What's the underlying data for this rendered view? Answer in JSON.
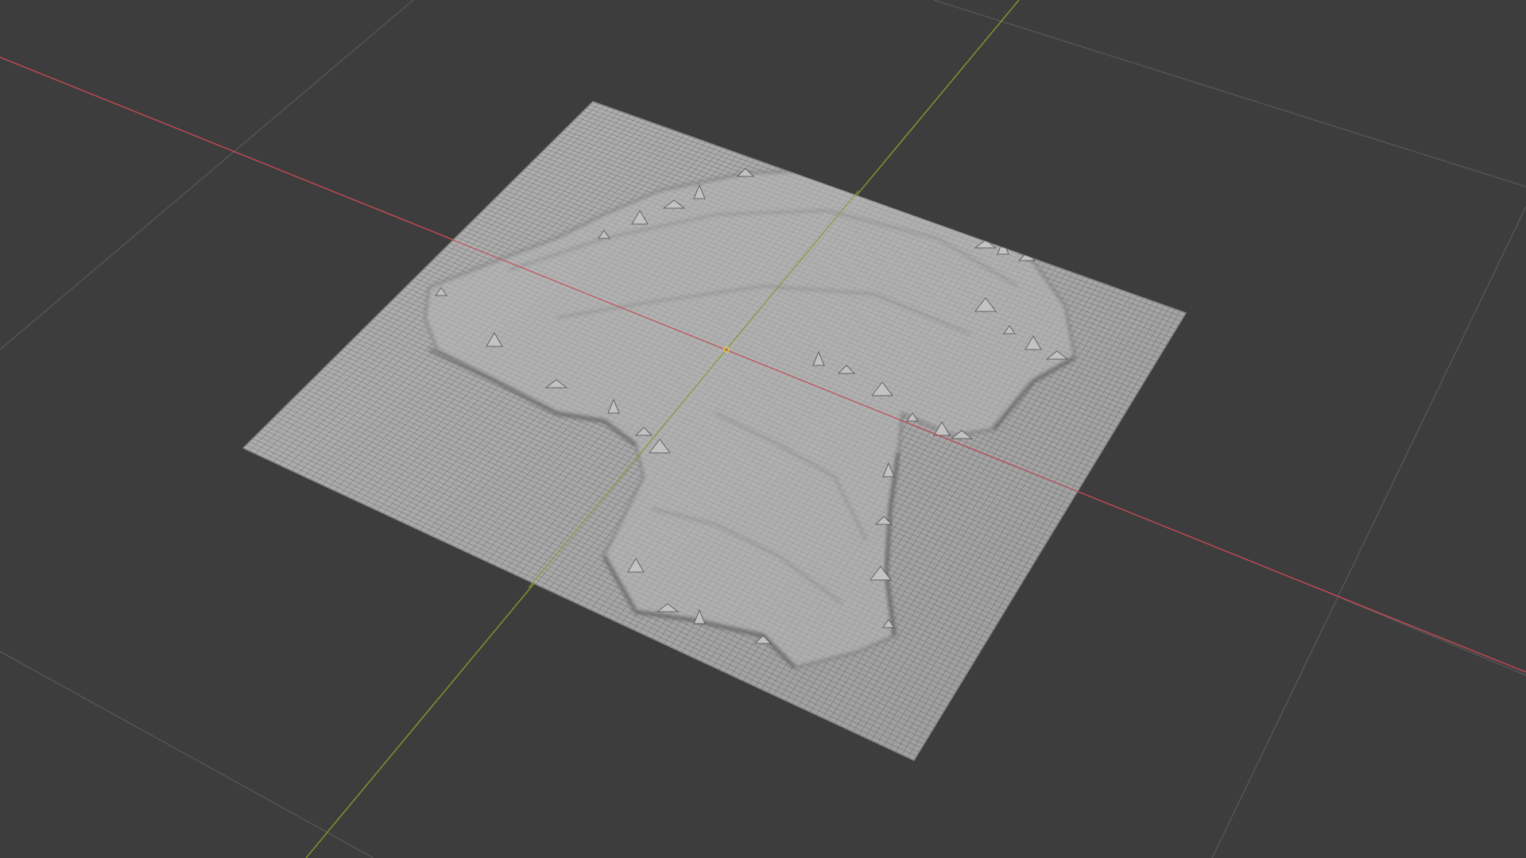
{
  "viewport": {
    "mode": "3d-viewport",
    "shading": "wireframe-over-solid",
    "colors": {
      "background": "#3d3d3d",
      "grid": "#555555",
      "x_axis": "#c54a55",
      "y_axis": "#7e9b2e",
      "mesh_fill": "#a9a9a9",
      "mesh_wire": "#2c2c2c",
      "origin": "#e6c24a"
    },
    "object": {
      "type": "displaced-plane",
      "icon": "mesh-icon",
      "selected": false
    }
  }
}
